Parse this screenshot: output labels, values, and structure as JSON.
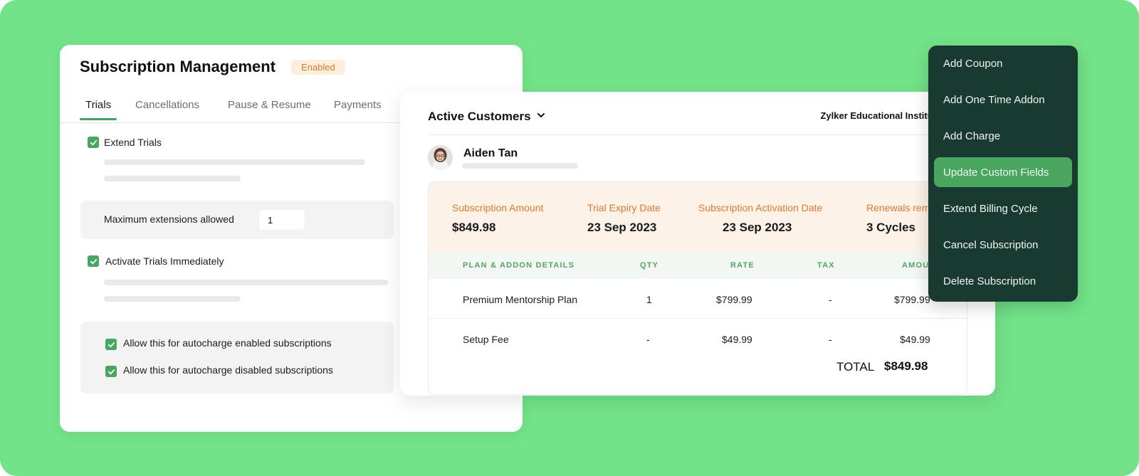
{
  "subscription_card": {
    "title": "Subscription Management",
    "status_badge": "Enabled",
    "tabs": [
      {
        "label": "Trials",
        "active": true
      },
      {
        "label": "Cancellations",
        "active": false
      },
      {
        "label": "Pause & Resume",
        "active": false
      },
      {
        "label": "Payments",
        "active": false
      }
    ],
    "extend_trials": {
      "label": "Extend Trials",
      "checked": true
    },
    "max_extensions": {
      "label": "Maximum extensions allowed",
      "value": "1"
    },
    "activate_trials": {
      "label": "Activate Trials Immediately",
      "checked": true
    },
    "autocharge_enabled": {
      "label": "Allow this for autocharge enabled subscriptions",
      "checked": true
    },
    "autocharge_disabled": {
      "label": "Allow this for autocharge disabled subscriptions",
      "checked": true
    }
  },
  "customers_card": {
    "view_title": "Active Customers",
    "organization": "Zylker Educational Institut",
    "customer_name": "Aiden Tan",
    "summary": [
      {
        "label": "Subscription Amount",
        "value": "$849.98"
      },
      {
        "label": "Trial Expiry Date",
        "value": "23 Sep 2023"
      },
      {
        "label": "Subscription Activation Date",
        "value": "23 Sep 2023"
      },
      {
        "label": "Renewals rem",
        "value": "3 Cycles"
      }
    ],
    "table": {
      "headers": [
        "PLAN & ADDON DETAILS",
        "QTY",
        "RATE",
        "TAX",
        "AMOUN"
      ],
      "rows": [
        [
          "Premium Mentorship Plan",
          "1",
          "$799.99",
          "-",
          "$799.99"
        ],
        [
          "Setup Fee",
          "-",
          "$49.99",
          "-",
          "$49.99"
        ]
      ]
    },
    "total_label": "TOTAL",
    "total_value": "$849.98"
  },
  "actions_menu": {
    "items": [
      {
        "label": "Add Coupon"
      },
      {
        "label": "Add One Time Addon"
      },
      {
        "label": "Add Charge"
      },
      {
        "label": "Update Custom Fields",
        "highlighted": true
      },
      {
        "label": "Extend Billing Cycle"
      },
      {
        "label": "Cancel Subscription"
      },
      {
        "label": "Delete Subscription"
      }
    ]
  },
  "colors": {
    "background": "#72e389",
    "accent_green": "#48a65e",
    "menu_background": "#193a30",
    "badge_orange": "#e07a2a",
    "summary_strip": "#fdf2e7"
  }
}
